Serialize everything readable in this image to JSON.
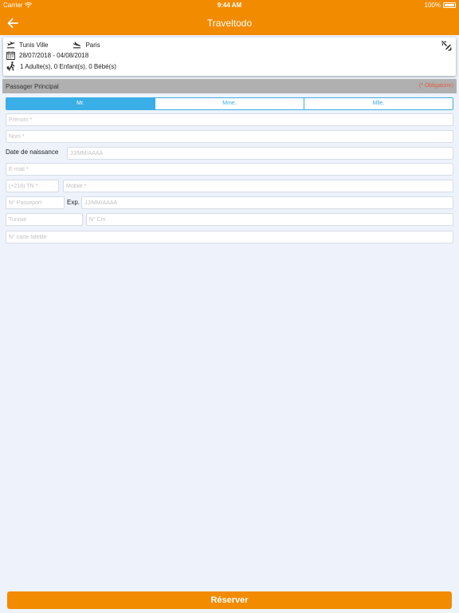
{
  "status_bar": {
    "carrier": "Carrier",
    "time": "9:44 AM",
    "battery": "100%"
  },
  "nav": {
    "title": "Traveltodo",
    "back_icon": "arrow-left-icon"
  },
  "trip": {
    "departure_city": "Tunis Ville",
    "arrival_city": "Paris",
    "dates": "28/07/2018 - 04/08/2018",
    "passengers": "1 Adulte(s), 0 Enfant(s), 0 Bébé(s)"
  },
  "section": {
    "title": "Passager Principal",
    "required_note": "(* Obligatoire)"
  },
  "civility": {
    "options": [
      "Mr.",
      "Mme.",
      "Mlle."
    ],
    "selected": "Mr."
  },
  "form": {
    "prenom_placeholder": "Prénom *",
    "nom_placeholder": "Nom *",
    "birth_label": "Date de naissance",
    "birth_placeholder": "JJ/MM/AAAA",
    "email_placeholder": "E-mail *",
    "phone_code_placeholder": "(+216) TN *",
    "mobile_placeholder": "Mobile *",
    "passport_placeholder": "N° Passeport",
    "exp_label": "Exp.",
    "exp_placeholder": "JJ/MM/AAAA",
    "country_placeholder": "Tunisie",
    "cin_placeholder": "N° Cin",
    "loyalty_placeholder": "N° carte fidelité"
  },
  "actions": {
    "reserve_label": "Réserver"
  },
  "colors": {
    "brand_orange": "#f28b00",
    "accent_blue": "#3aaee6",
    "required_red": "#e06040"
  }
}
